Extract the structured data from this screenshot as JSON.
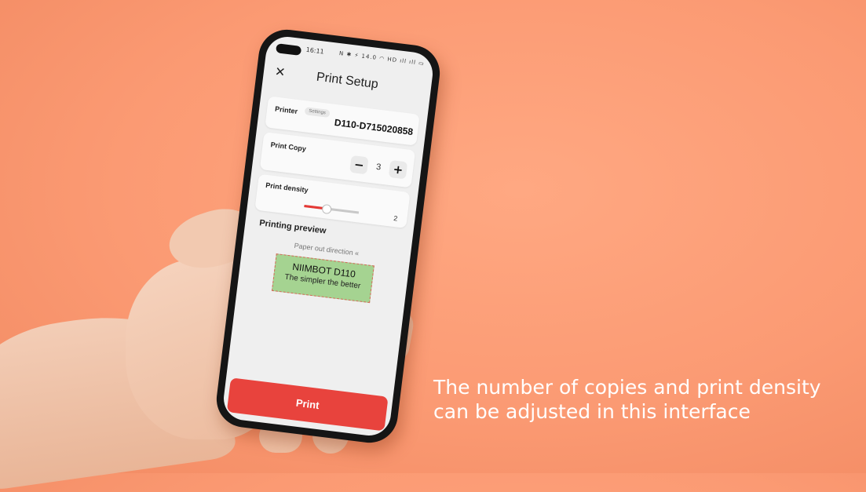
{
  "status_bar": {
    "time": "16:11",
    "icons": "N ✱ ⚡ 14.0 ◠ HD ıll ıll ▭"
  },
  "header": {
    "title": "Print Setup",
    "close_glyph": "✕"
  },
  "printer": {
    "label": "Printer",
    "settings_chip": "Settings",
    "name": "D110-D715020858"
  },
  "print_copy": {
    "label": "Print Copy",
    "minus": "−",
    "plus": "+",
    "value": "3"
  },
  "print_density": {
    "label": "Print density",
    "value": "2",
    "level_fraction": 0.4
  },
  "preview": {
    "title": "Printing preview",
    "paper_direction": "Paper out direction «",
    "label_line1": "NIIMBOT D110",
    "label_line2": "The simpler the better"
  },
  "print_button": {
    "label": "Print"
  },
  "caption": {
    "line1": "The number of copies and print density",
    "line2": "can be adjusted in this interface"
  },
  "colors": {
    "background": "#fb9a73",
    "accent": "#e8433d",
    "label_green": "#a5d391"
  }
}
